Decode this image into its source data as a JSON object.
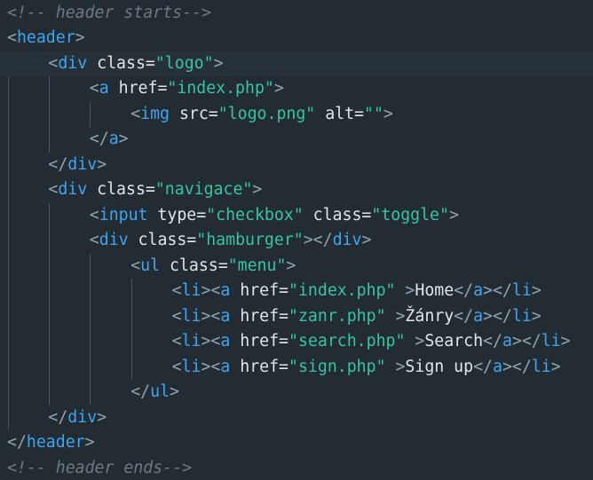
{
  "editor": {
    "colors": {
      "background": "#232b33",
      "current_line": "#27313a",
      "punctuation": "#8fa6b2",
      "tag": "#3fa7f2",
      "attribute": "#e1e6ea",
      "string": "#36c5a6",
      "text": "#e1e6ea",
      "comment": "#6c7a86",
      "indent_guide": "#4a5561"
    },
    "current_line": 2,
    "lines": [
      {
        "indent": 0,
        "tokens": [
          {
            "t": "cmt",
            "v": "<!-- header starts-->"
          }
        ]
      },
      {
        "indent": 0,
        "tokens": [
          {
            "t": "punct",
            "v": "<"
          },
          {
            "t": "tag",
            "v": "header"
          },
          {
            "t": "punct",
            "v": ">"
          }
        ]
      },
      {
        "indent": 1,
        "tokens": [
          {
            "t": "punct",
            "v": "<"
          },
          {
            "t": "tag",
            "v": "div"
          },
          {
            "t": "attr",
            "v": " class="
          },
          {
            "t": "str",
            "v": "\"logo\""
          },
          {
            "t": "punct",
            "v": ">"
          }
        ]
      },
      {
        "indent": 2,
        "tokens": [
          {
            "t": "punct",
            "v": "<"
          },
          {
            "t": "tag",
            "v": "a"
          },
          {
            "t": "attr",
            "v": " href="
          },
          {
            "t": "str",
            "v": "\"index.php\""
          },
          {
            "t": "punct",
            "v": ">"
          }
        ]
      },
      {
        "indent": 3,
        "tokens": [
          {
            "t": "punct",
            "v": "<"
          },
          {
            "t": "tag",
            "v": "img"
          },
          {
            "t": "attr",
            "v": " src="
          },
          {
            "t": "str",
            "v": "\"logo.png\""
          },
          {
            "t": "attr",
            "v": " alt="
          },
          {
            "t": "str",
            "v": "\"\""
          },
          {
            "t": "punct",
            "v": ">"
          }
        ]
      },
      {
        "indent": 2,
        "tokens": [
          {
            "t": "punct",
            "v": "</"
          },
          {
            "t": "tag",
            "v": "a"
          },
          {
            "t": "punct",
            "v": ">"
          }
        ]
      },
      {
        "indent": 1,
        "tokens": [
          {
            "t": "punct",
            "v": "</"
          },
          {
            "t": "tag",
            "v": "div"
          },
          {
            "t": "punct",
            "v": ">"
          }
        ]
      },
      {
        "indent": 1,
        "tokens": [
          {
            "t": "punct",
            "v": "<"
          },
          {
            "t": "tag",
            "v": "div"
          },
          {
            "t": "attr",
            "v": " class="
          },
          {
            "t": "str",
            "v": "\"navigace\""
          },
          {
            "t": "punct",
            "v": ">"
          }
        ]
      },
      {
        "indent": 2,
        "tokens": [
          {
            "t": "punct",
            "v": "<"
          },
          {
            "t": "tag",
            "v": "input"
          },
          {
            "t": "attr",
            "v": " type="
          },
          {
            "t": "str",
            "v": "\"checkbox\""
          },
          {
            "t": "attr",
            "v": " class="
          },
          {
            "t": "str",
            "v": "\"toggle\""
          },
          {
            "t": "punct",
            "v": ">"
          }
        ]
      },
      {
        "indent": 2,
        "tokens": [
          {
            "t": "punct",
            "v": "<"
          },
          {
            "t": "tag",
            "v": "div"
          },
          {
            "t": "attr",
            "v": " class="
          },
          {
            "t": "str",
            "v": "\"hamburger\""
          },
          {
            "t": "punct",
            "v": "></"
          },
          {
            "t": "tag",
            "v": "div"
          },
          {
            "t": "punct",
            "v": ">"
          }
        ]
      },
      {
        "indent": 3,
        "tokens": [
          {
            "t": "punct",
            "v": "<"
          },
          {
            "t": "tag",
            "v": "ul"
          },
          {
            "t": "attr",
            "v": " class="
          },
          {
            "t": "str",
            "v": "\"menu\""
          },
          {
            "t": "punct",
            "v": ">"
          }
        ]
      },
      {
        "indent": 4,
        "tokens": [
          {
            "t": "punct",
            "v": "<"
          },
          {
            "t": "tag",
            "v": "li"
          },
          {
            "t": "punct",
            "v": "><"
          },
          {
            "t": "tag",
            "v": "a"
          },
          {
            "t": "attr",
            "v": " href="
          },
          {
            "t": "str",
            "v": "\"index.php\""
          },
          {
            "t": "punct",
            "v": " >"
          },
          {
            "t": "text",
            "v": "Home"
          },
          {
            "t": "punct",
            "v": "</"
          },
          {
            "t": "tag",
            "v": "a"
          },
          {
            "t": "punct",
            "v": "></"
          },
          {
            "t": "tag",
            "v": "li"
          },
          {
            "t": "punct",
            "v": ">"
          }
        ]
      },
      {
        "indent": 4,
        "tokens": [
          {
            "t": "punct",
            "v": "<"
          },
          {
            "t": "tag",
            "v": "li"
          },
          {
            "t": "punct",
            "v": "><"
          },
          {
            "t": "tag",
            "v": "a"
          },
          {
            "t": "attr",
            "v": " href="
          },
          {
            "t": "str",
            "v": "\"zanr.php\""
          },
          {
            "t": "punct",
            "v": " >"
          },
          {
            "t": "text",
            "v": "Žánry"
          },
          {
            "t": "punct",
            "v": "</"
          },
          {
            "t": "tag",
            "v": "a"
          },
          {
            "t": "punct",
            "v": "></"
          },
          {
            "t": "tag",
            "v": "li"
          },
          {
            "t": "punct",
            "v": ">"
          }
        ]
      },
      {
        "indent": 4,
        "tokens": [
          {
            "t": "punct",
            "v": "<"
          },
          {
            "t": "tag",
            "v": "li"
          },
          {
            "t": "punct",
            "v": "><"
          },
          {
            "t": "tag",
            "v": "a"
          },
          {
            "t": "attr",
            "v": " href="
          },
          {
            "t": "str",
            "v": "\"search.php\""
          },
          {
            "t": "punct",
            "v": " >"
          },
          {
            "t": "text",
            "v": "Search"
          },
          {
            "t": "punct",
            "v": "</"
          },
          {
            "t": "tag",
            "v": "a"
          },
          {
            "t": "punct",
            "v": "></"
          },
          {
            "t": "tag",
            "v": "li"
          },
          {
            "t": "punct",
            "v": ">"
          }
        ]
      },
      {
        "indent": 4,
        "tokens": [
          {
            "t": "punct",
            "v": "<"
          },
          {
            "t": "tag",
            "v": "li"
          },
          {
            "t": "punct",
            "v": "><"
          },
          {
            "t": "tag",
            "v": "a"
          },
          {
            "t": "attr",
            "v": " href="
          },
          {
            "t": "str",
            "v": "\"sign.php\""
          },
          {
            "t": "punct",
            "v": " >"
          },
          {
            "t": "text",
            "v": "Sign up"
          },
          {
            "t": "punct",
            "v": "</"
          },
          {
            "t": "tag",
            "v": "a"
          },
          {
            "t": "punct",
            "v": "></"
          },
          {
            "t": "tag",
            "v": "li"
          },
          {
            "t": "punct",
            "v": ">"
          }
        ]
      },
      {
        "indent": 3,
        "tokens": [
          {
            "t": "punct",
            "v": "</"
          },
          {
            "t": "tag",
            "v": "ul"
          },
          {
            "t": "punct",
            "v": ">"
          }
        ]
      },
      {
        "indent": 1,
        "tokens": [
          {
            "t": "punct",
            "v": "</"
          },
          {
            "t": "tag",
            "v": "div"
          },
          {
            "t": "punct",
            "v": ">"
          }
        ]
      },
      {
        "indent": 0,
        "tokens": [
          {
            "t": "punct",
            "v": "</"
          },
          {
            "t": "tag",
            "v": "header"
          },
          {
            "t": "punct",
            "v": ">"
          }
        ]
      },
      {
        "indent": 0,
        "tokens": [
          {
            "t": "cmt",
            "v": "<!-- header ends-->"
          }
        ]
      }
    ]
  }
}
